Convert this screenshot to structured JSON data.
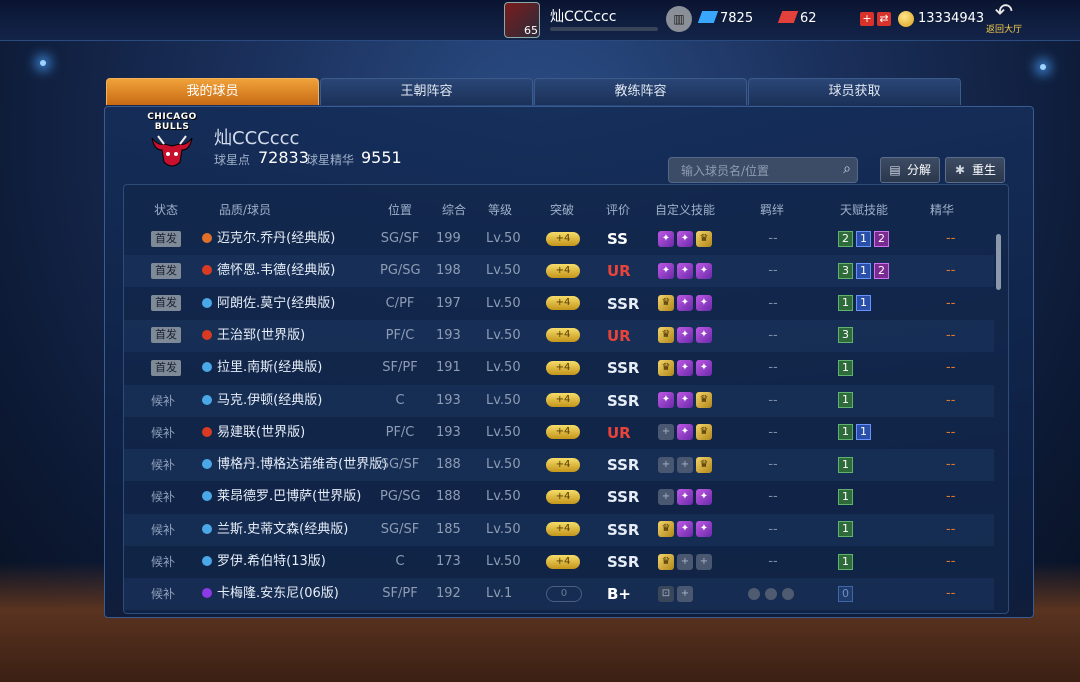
{
  "topbar": {
    "player_level": "65",
    "username": "灿CCCccc",
    "tickets": "7825",
    "rubies": "62",
    "coins": "13334943",
    "back_label": "返回大厅"
  },
  "tabs": [
    "我的球员",
    "王朝阵容",
    "教练阵容",
    "球员获取"
  ],
  "team": {
    "logo_text": [
      "CHICAGO",
      "BULLS"
    ],
    "name": "灿CCCccc",
    "star_points_label": "球星点",
    "star_points": "72833",
    "essence_label": "球星精华",
    "essence": "9551"
  },
  "search": {
    "placeholder": "输入球员名/位置"
  },
  "buttons": {
    "decompose": "分解",
    "rebirth": "重生"
  },
  "columns": [
    "状态",
    "品质/球员",
    "位置",
    "综合",
    "等级",
    "突破",
    "评价",
    "自定义技能",
    "羁绊",
    "天赋技能",
    "精华"
  ],
  "rows": [
    {
      "status": "首发",
      "starter": true,
      "dot": "#e0702a",
      "name": "迈克尔.乔丹(经典版)",
      "pos": "SG/SF",
      "ovr": "199",
      "lvl": "Lv.50",
      "break": "+4",
      "rating": "SS",
      "rcls": "ss",
      "skills": [
        "p",
        "p",
        "g"
      ],
      "bond": "--",
      "talents": [
        [
          "2",
          "gr"
        ],
        [
          "1",
          "bl"
        ],
        [
          "2",
          "pu"
        ]
      ],
      "essence": "--"
    },
    {
      "status": "首发",
      "starter": true,
      "dot": "#d83a22",
      "name": "德怀恩.韦德(经典版)",
      "pos": "PG/SG",
      "ovr": "198",
      "lvl": "Lv.50",
      "break": "+4",
      "rating": "UR",
      "rcls": "ur",
      "skills": [
        "p",
        "p",
        "p"
      ],
      "bond": "--",
      "talents": [
        [
          "3",
          "gr"
        ],
        [
          "1",
          "bl"
        ],
        [
          "2",
          "pu"
        ]
      ],
      "essence": "--"
    },
    {
      "status": "首发",
      "starter": true,
      "dot": "#4aa8e6",
      "name": "阿朗佐.莫宁(经典版)",
      "pos": "C/PF",
      "ovr": "197",
      "lvl": "Lv.50",
      "break": "+4",
      "rating": "SSR",
      "rcls": "ssr",
      "skills": [
        "g",
        "p",
        "p"
      ],
      "bond": "--",
      "talents": [
        [
          "1",
          "gr"
        ],
        [
          "1",
          "bl"
        ]
      ],
      "essence": "--"
    },
    {
      "status": "首发",
      "starter": true,
      "dot": "#d83a22",
      "name": "王治郅(世界版)",
      "pos": "PF/C",
      "ovr": "193",
      "lvl": "Lv.50",
      "break": "+4",
      "rating": "UR",
      "rcls": "ur",
      "skills": [
        "g",
        "p",
        "p"
      ],
      "bond": "--",
      "talents": [
        [
          "3",
          "gr"
        ]
      ],
      "essence": "--"
    },
    {
      "status": "首发",
      "starter": true,
      "dot": "#4aa8e6",
      "name": "拉里.南斯(经典版)",
      "pos": "SF/PF",
      "ovr": "191",
      "lvl": "Lv.50",
      "break": "+4",
      "rating": "SSR",
      "rcls": "ssr",
      "skills": [
        "g",
        "p",
        "p"
      ],
      "bond": "--",
      "talents": [
        [
          "1",
          "gr"
        ]
      ],
      "essence": "--"
    },
    {
      "status": "候补",
      "starter": false,
      "dot": "#4aa8e6",
      "name": "马克.伊顿(经典版)",
      "pos": "C",
      "ovr": "193",
      "lvl": "Lv.50",
      "break": "+4",
      "rating": "SSR",
      "rcls": "ssr",
      "skills": [
        "p",
        "p",
        "g"
      ],
      "bond": "--",
      "talents": [
        [
          "1",
          "gr"
        ]
      ],
      "essence": "--"
    },
    {
      "status": "候补",
      "starter": false,
      "dot": "#d83a22",
      "name": "易建联(世界版)",
      "pos": "PF/C",
      "ovr": "193",
      "lvl": "Lv.50",
      "break": "+4",
      "rating": "UR",
      "rcls": "ur",
      "skills": [
        "e",
        "p",
        "g"
      ],
      "bond": "--",
      "talents": [
        [
          "1",
          "gr"
        ],
        [
          "1",
          "bl"
        ]
      ],
      "essence": "--"
    },
    {
      "status": "候补",
      "starter": false,
      "dot": "#4aa8e6",
      "name": "博格丹.博格达诺维奇(世界版)",
      "pos": "SG/SF",
      "ovr": "188",
      "lvl": "Lv.50",
      "break": "+4",
      "rating": "SSR",
      "rcls": "ssr",
      "skills": [
        "e",
        "e",
        "g"
      ],
      "bond": "--",
      "talents": [
        [
          "1",
          "gr"
        ]
      ],
      "essence": "--"
    },
    {
      "status": "候补",
      "starter": false,
      "dot": "#4aa8e6",
      "name": "莱昂德罗.巴博萨(世界版)",
      "pos": "PG/SG",
      "ovr": "188",
      "lvl": "Lv.50",
      "break": "+4",
      "rating": "SSR",
      "rcls": "ssr",
      "skills": [
        "e",
        "p",
        "p"
      ],
      "bond": "--",
      "talents": [
        [
          "1",
          "gr"
        ]
      ],
      "essence": "--"
    },
    {
      "status": "候补",
      "starter": false,
      "dot": "#4aa8e6",
      "name": "兰斯.史蒂文森(经典版)",
      "pos": "SG/SF",
      "ovr": "185",
      "lvl": "Lv.50",
      "break": "+4",
      "rating": "SSR",
      "rcls": "ssr",
      "skills": [
        "g",
        "p",
        "p"
      ],
      "bond": "--",
      "talents": [
        [
          "1",
          "gr"
        ]
      ],
      "essence": "--"
    },
    {
      "status": "候补",
      "starter": false,
      "dot": "#4aa8e6",
      "name": "罗伊.希伯特(13版)",
      "pos": "C",
      "ovr": "173",
      "lvl": "Lv.50",
      "break": "+4",
      "rating": "SSR",
      "rcls": "ssr",
      "skills": [
        "g",
        "e",
        "e"
      ],
      "bond": "--",
      "talents": [
        [
          "1",
          "gr"
        ]
      ],
      "essence": "--"
    },
    {
      "status": "候补",
      "starter": false,
      "dot": "#8a3ae6",
      "name": "卡梅隆.安东尼(06版)",
      "pos": "SF/PF",
      "ovr": "192",
      "lvl": "Lv.1",
      "break": "0",
      "rating": "B+",
      "rcls": "bp",
      "skills": [
        "lock",
        "e"
      ],
      "bond": "",
      "talents": [
        [
          "0",
          "nv"
        ]
      ],
      "essence": "--"
    }
  ]
}
